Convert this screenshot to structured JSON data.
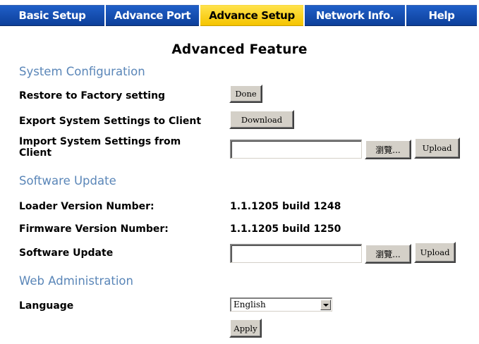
{
  "tabs": [
    {
      "label": "Basic Setup",
      "active": false
    },
    {
      "label": "Advance Port",
      "active": false
    },
    {
      "label": "Advance Setup",
      "active": true
    },
    {
      "label": "Network Info.",
      "active": false
    },
    {
      "label": "Help",
      "active": false
    }
  ],
  "page_title": "Advanced Feature",
  "system_configuration": {
    "heading": "System Configuration",
    "restore_label": "Restore to Factory setting",
    "restore_button": "Done",
    "export_label": "Export System Settings to Client",
    "export_button": "Download",
    "import_label_line1": "Import System Settings from",
    "import_label_line2": "Client",
    "import_file_value": "",
    "import_browse_button": "瀏覽...",
    "import_upload_button": "Upload"
  },
  "software_update": {
    "heading": "Software Update",
    "loader_label": "Loader Version Number:",
    "loader_value": "1.1.1205 build 1248",
    "firmware_label": "Firmware Version Number:",
    "firmware_value": "1.1.1205 build 1250",
    "update_label": "Software Update",
    "update_file_value": "",
    "update_browse_button": "瀏覽...",
    "update_upload_button": "Upload"
  },
  "web_administration": {
    "heading": "Web Administration",
    "language_label": "Language",
    "language_selected": "English",
    "apply_button": "Apply"
  },
  "colors": {
    "tab_blue": "#1650b8",
    "tab_active_yellow": "#f7cf10",
    "section_heading": "#5a86b8",
    "button_face": "#d4d0c8"
  }
}
